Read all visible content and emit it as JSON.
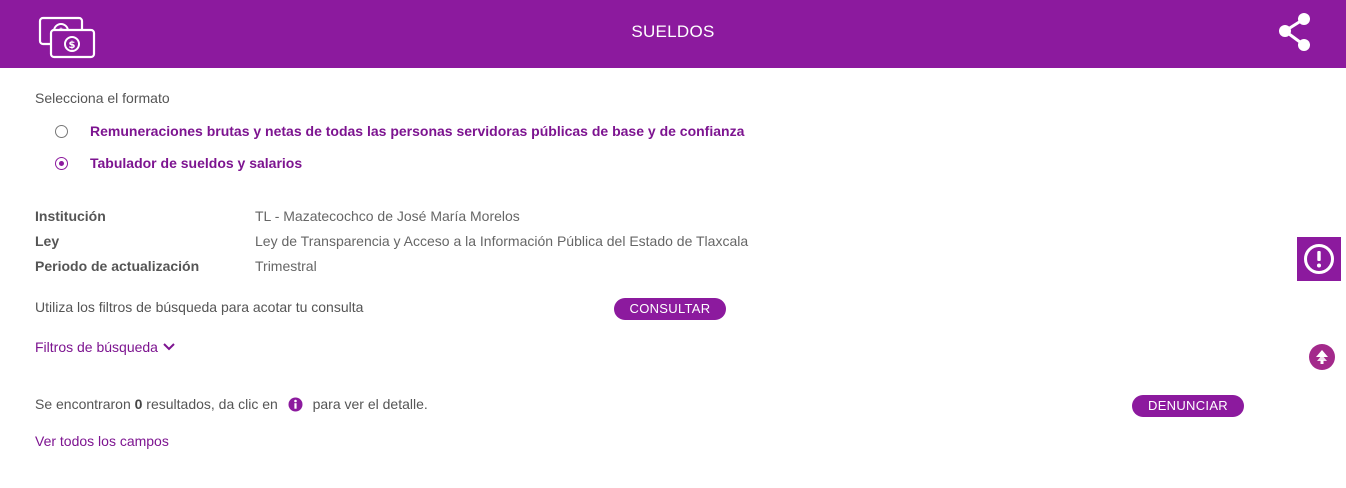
{
  "header": {
    "title": "SUELDOS",
    "logo_icon": "money-bills-icon",
    "share_icon": "share-icon",
    "background": "#8c1a9e"
  },
  "format": {
    "label": "Selecciona el formato",
    "options": [
      {
        "label": "Remuneraciones brutas y netas de todas las personas servidoras públicas de base y de confianza",
        "selected": false
      },
      {
        "label": "Tabulador de sueldos y salarios",
        "selected": true
      }
    ]
  },
  "info": [
    {
      "key": "Institución",
      "value": "TL - Mazatecochco de José María Morelos"
    },
    {
      "key": "Ley",
      "value": "Ley de Transparencia y Acceso a la Información Pública del Estado de Tlaxcala"
    },
    {
      "key": "Periodo de actualización",
      "value": "Trimestral"
    }
  ],
  "search": {
    "hint": "Utiliza los filtros de búsqueda para acotar tu consulta",
    "consult_label": "CONSULTAR",
    "filters_label": "Filtros de búsqueda"
  },
  "results": {
    "prefix": "Se encontraron ",
    "count": "0",
    "middle": " resultados, da clic en ",
    "suffix": " para ver el detalle.",
    "report_label": "DENUNCIAR",
    "all_fields_label": "Ver todos los campos"
  },
  "side": {
    "alert_icon": "exclamation-circle-icon",
    "scroll_icon": "scroll-up-icon"
  }
}
